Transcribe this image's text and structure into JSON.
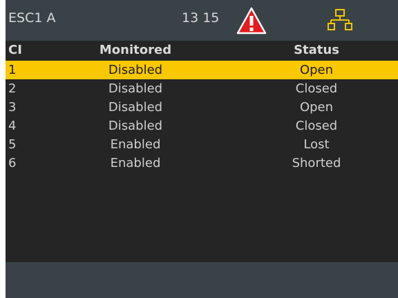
{
  "header": {
    "title": "ESC1 A",
    "time": "13 15",
    "colors": {
      "background": "#394347",
      "warning": "#e11d21",
      "network": "#f7c600"
    }
  },
  "table": {
    "columns": [
      "CI",
      "Monitored",
      "Status"
    ],
    "rows": [
      {
        "ci": "1",
        "monitored": "Disabled",
        "status": "Open",
        "selected": true
      },
      {
        "ci": "2",
        "monitored": "Disabled",
        "status": "Closed",
        "selected": false
      },
      {
        "ci": "3",
        "monitored": "Disabled",
        "status": "Open",
        "selected": false
      },
      {
        "ci": "4",
        "monitored": "Disabled",
        "status": "Closed",
        "selected": false
      },
      {
        "ci": "5",
        "monitored": "Enabled",
        "status": "Lost",
        "selected": false
      },
      {
        "ci": "6",
        "monitored": "Enabled",
        "status": "Shorted",
        "selected": false
      }
    ],
    "selection_color": "#f9c800"
  },
  "icons": [
    "warning-triangle-icon",
    "network-icon"
  ]
}
